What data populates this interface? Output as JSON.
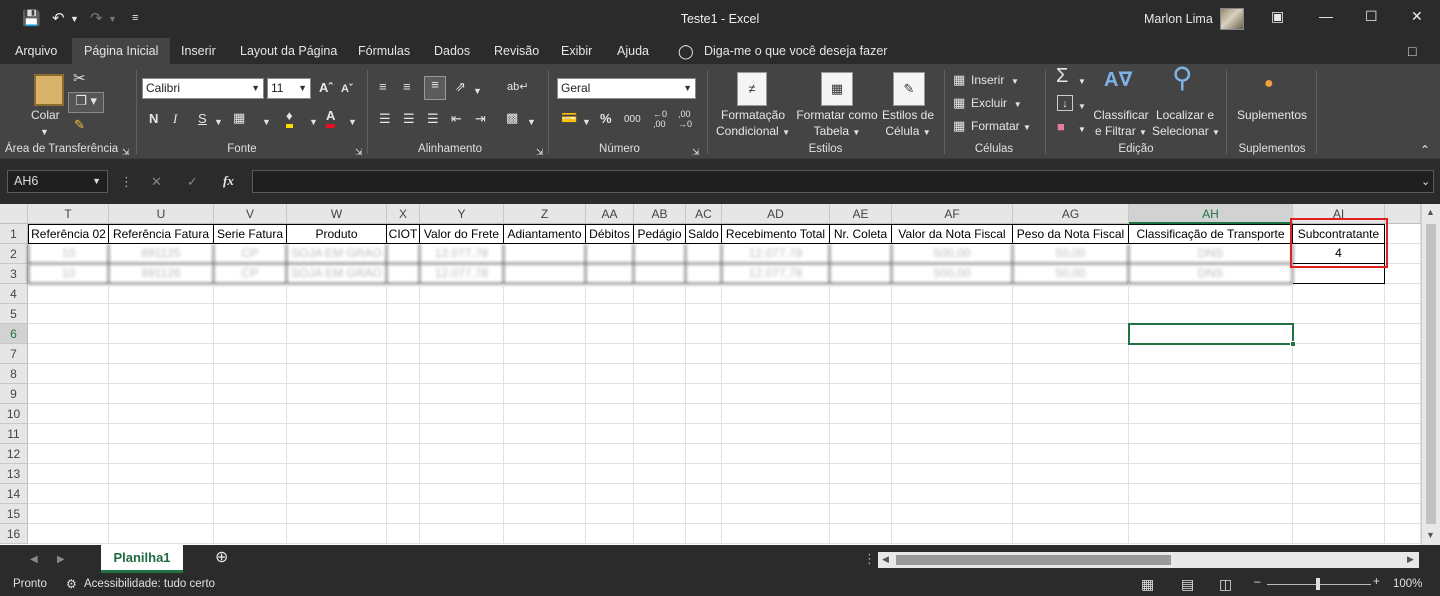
{
  "window": {
    "title": "Teste1  -  Excel",
    "user": "Marlon Lima"
  },
  "tabs": [
    "Arquivo",
    "Página Inicial",
    "Inserir",
    "Layout da Página",
    "Fórmulas",
    "Dados",
    "Revisão",
    "Exibir",
    "Ajuda"
  ],
  "tell_me": "Diga-me o que você deseja fazer",
  "ribbon": {
    "clipboard": {
      "paste": "Colar",
      "label": "Área de Transferência"
    },
    "font": {
      "name": "Calibri",
      "size": "11",
      "bold": "N",
      "italic": "I",
      "underline": "S",
      "label": "Fonte"
    },
    "alignment": {
      "label": "Alinhamento"
    },
    "number": {
      "format": "Geral",
      "label": "Número"
    },
    "styles": {
      "cond_line1": "Formatação",
      "cond_line2": "Condicional",
      "table_line1": "Formatar como",
      "table_line2": "Tabela",
      "cell_line1": "Estilos de",
      "cell_line2": "Célula",
      "label": "Estilos"
    },
    "cells": {
      "insert": "Inserir",
      "delete": "Excluir",
      "format": "Formatar",
      "label": "Células"
    },
    "editing": {
      "sort_line1": "Classificar",
      "sort_line2": "e Filtrar",
      "find_line1": "Localizar e",
      "find_line2": "Selecionar",
      "label": "Edição"
    },
    "addins": {
      "button": "Suplementos",
      "label": "Suplementos"
    }
  },
  "formula_bar": {
    "name_box": "AH6",
    "fx": "fx",
    "content": ""
  },
  "columns": [
    {
      "letter": "T",
      "header": "Referência 02"
    },
    {
      "letter": "U",
      "header": "Referência Fatura"
    },
    {
      "letter": "V",
      "header": "Serie Fatura"
    },
    {
      "letter": "W",
      "header": "Produto"
    },
    {
      "letter": "X",
      "header": "CIOT"
    },
    {
      "letter": "Y",
      "header": "Valor do Frete"
    },
    {
      "letter": "Z",
      "header": "Adiantamento"
    },
    {
      "letter": "AA",
      "header": "Débitos"
    },
    {
      "letter": "AB",
      "header": "Pedágio"
    },
    {
      "letter": "AC",
      "header": "Saldo"
    },
    {
      "letter": "AD",
      "header": "Recebimento Total"
    },
    {
      "letter": "AE",
      "header": "Nr. Coleta"
    },
    {
      "letter": "AF",
      "header": "Valor da Nota Fiscal"
    },
    {
      "letter": "AG",
      "header": "Peso da Nota Fiscal"
    },
    {
      "letter": "AH",
      "header": "Classificação de Transporte"
    },
    {
      "letter": "AI",
      "header": "Subcontratante"
    }
  ],
  "row_numbers": [
    "1",
    "2",
    "3",
    "4",
    "5",
    "6",
    "7",
    "8",
    "9",
    "10",
    "11",
    "12",
    "13",
    "14",
    "15",
    "16"
  ],
  "data_rows": [
    [
      "10",
      "891125",
      "CP",
      "SOJA EM GRAO",
      "",
      "12.077,78",
      "",
      "",
      "",
      "",
      "12.077,78",
      "",
      "500,00",
      "50,00",
      "DNS",
      "4"
    ],
    [
      "10",
      "891126",
      "CP",
      "SOJA EM GRAO",
      "",
      "12.077,78",
      "",
      "",
      "",
      "",
      "12.077,78",
      "",
      "500,00",
      "50,00",
      "DNS",
      ""
    ]
  ],
  "selected_cell": "AH6",
  "sheet": {
    "name": "Planilha1"
  },
  "status": {
    "ready": "Pronto",
    "accessibility": "Acessibilidade: tudo certo",
    "zoom": "100%"
  }
}
